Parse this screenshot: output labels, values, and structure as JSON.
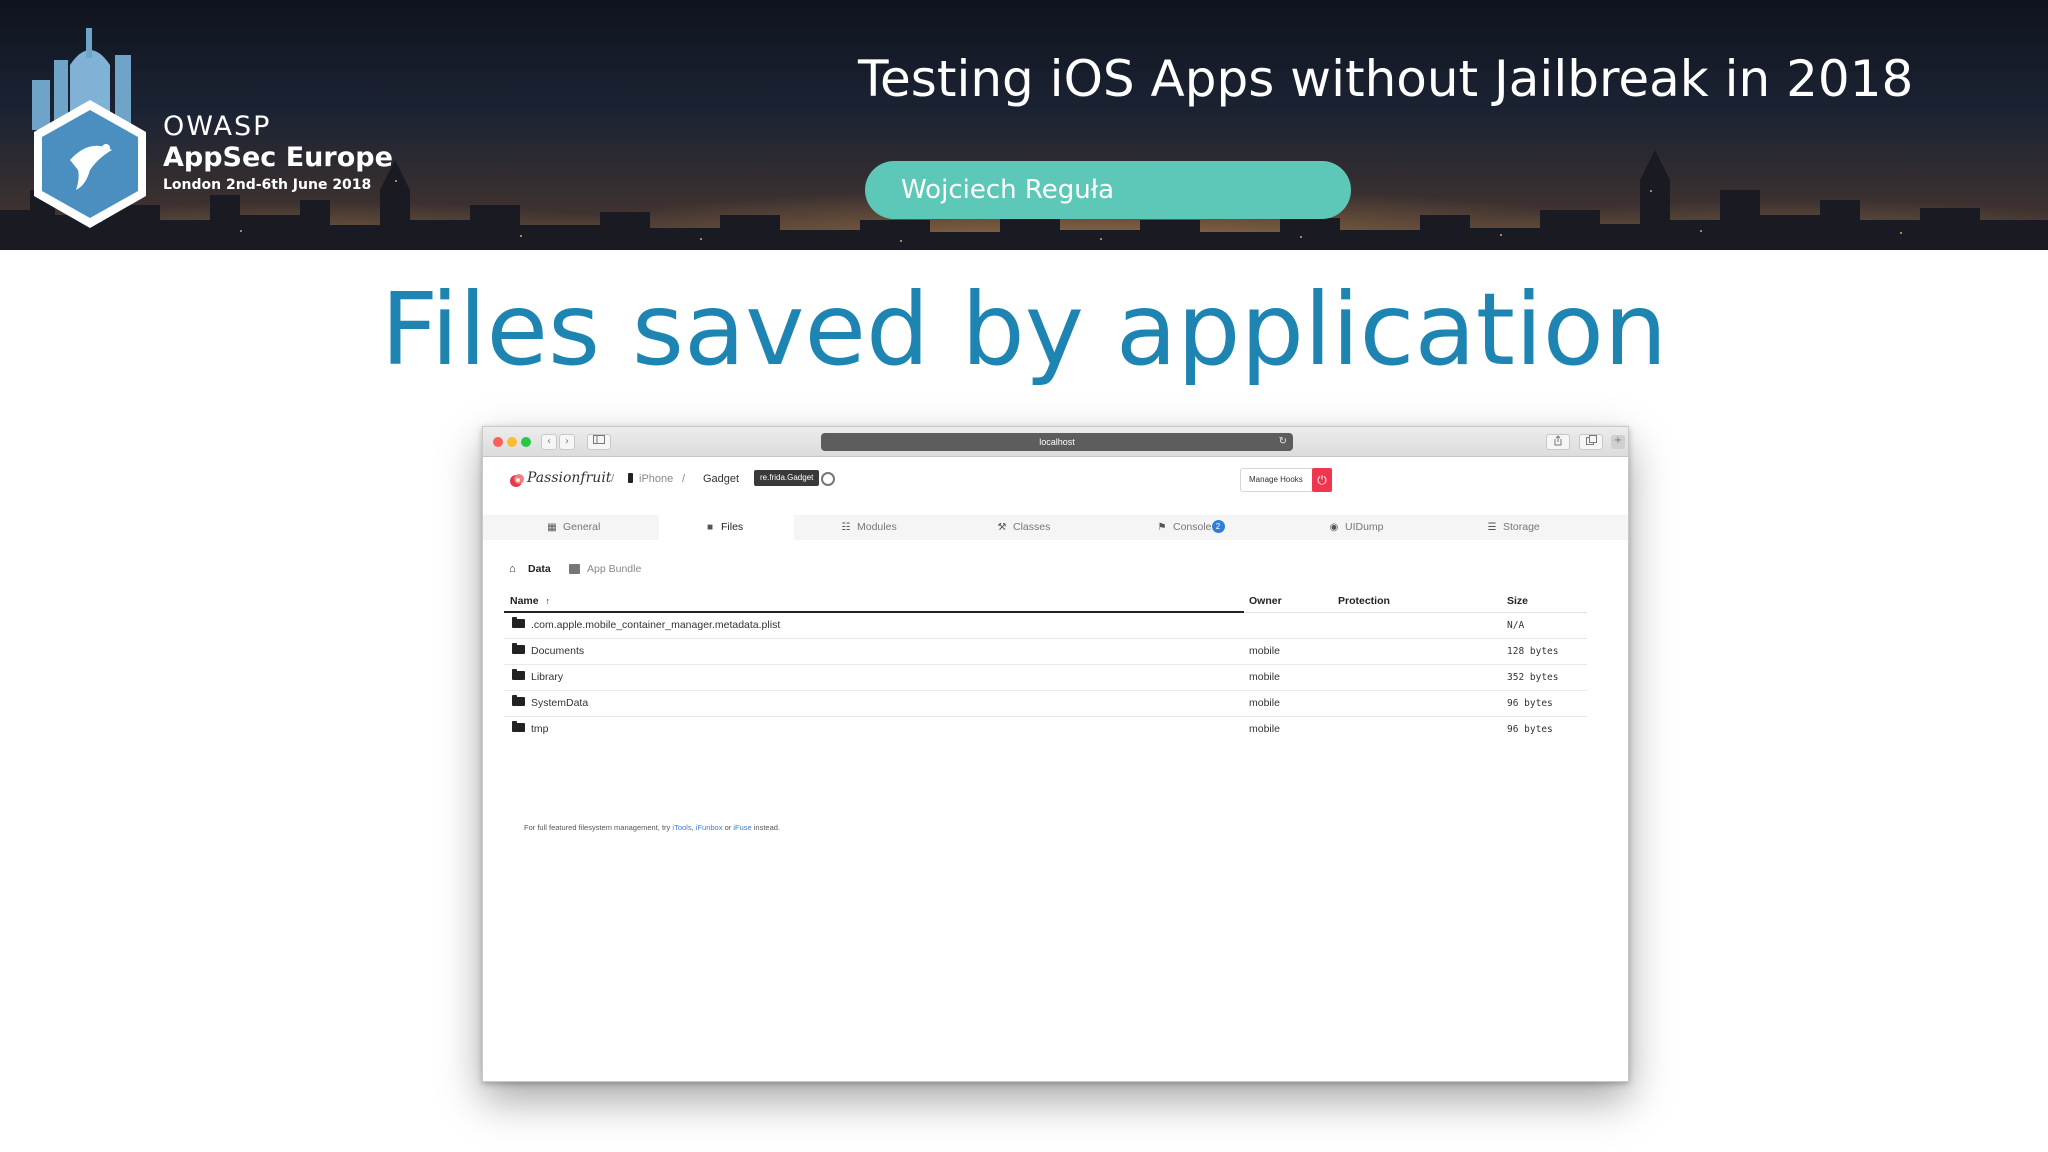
{
  "banner": {
    "org_line1": "OWASP",
    "org_line2": "AppSec Europe",
    "org_line3": "London 2nd-6th June 2018",
    "talk_title": "Testing iOS Apps without Jailbreak in 2018",
    "speaker": "Wojciech Reguła"
  },
  "slide": {
    "title": "Files saved by application"
  },
  "browser": {
    "url": "localhost",
    "nav_back": "‹",
    "nav_forward": "›"
  },
  "app": {
    "brand": "Passionfruit",
    "breadcrumb_sep": "/",
    "device": "iPhone",
    "app_name": "Gadget",
    "bundle_id": "re.frida.Gadget",
    "manage_hooks": "Manage Hooks",
    "tabs": [
      {
        "label": "General",
        "icon": "grid-icon"
      },
      {
        "label": "Files",
        "icon": "folder-icon"
      },
      {
        "label": "Modules",
        "icon": "modules-icon"
      },
      {
        "label": "Classes",
        "icon": "classes-icon"
      },
      {
        "label": "Console",
        "icon": "console-icon",
        "badge": "2"
      },
      {
        "label": "UIDump",
        "icon": "eye-icon"
      },
      {
        "label": "Storage",
        "icon": "storage-icon"
      }
    ],
    "path": {
      "data": "Data",
      "app_bundle": "App Bundle"
    },
    "table": {
      "headers": {
        "name": "Name",
        "owner": "Owner",
        "protection": "Protection",
        "size": "Size"
      },
      "rows": [
        {
          "name": ".com.apple.mobile_container_manager.metadata.plist",
          "owner": "",
          "protection": "",
          "size": "N/A"
        },
        {
          "name": "Documents",
          "owner": "mobile",
          "protection": "",
          "size": "128 bytes"
        },
        {
          "name": "Library",
          "owner": "mobile",
          "protection": "",
          "size": "352 bytes"
        },
        {
          "name": "SystemData",
          "owner": "mobile",
          "protection": "",
          "size": "96 bytes"
        },
        {
          "name": "tmp",
          "owner": "mobile",
          "protection": "",
          "size": "96 bytes"
        }
      ]
    },
    "footnote": {
      "prefix": "For full featured filesystem management, try",
      "link1": "iTools",
      "sep1": ",",
      "link2": "iFunbox",
      "or": "or",
      "link3": "iFuse",
      "suffix": "instead."
    }
  },
  "colors": {
    "title_blue": "#1e85b3",
    "speaker_pill": "#5ec8b8",
    "power_button": "#f0364f",
    "badge": "#2f7fd8"
  }
}
